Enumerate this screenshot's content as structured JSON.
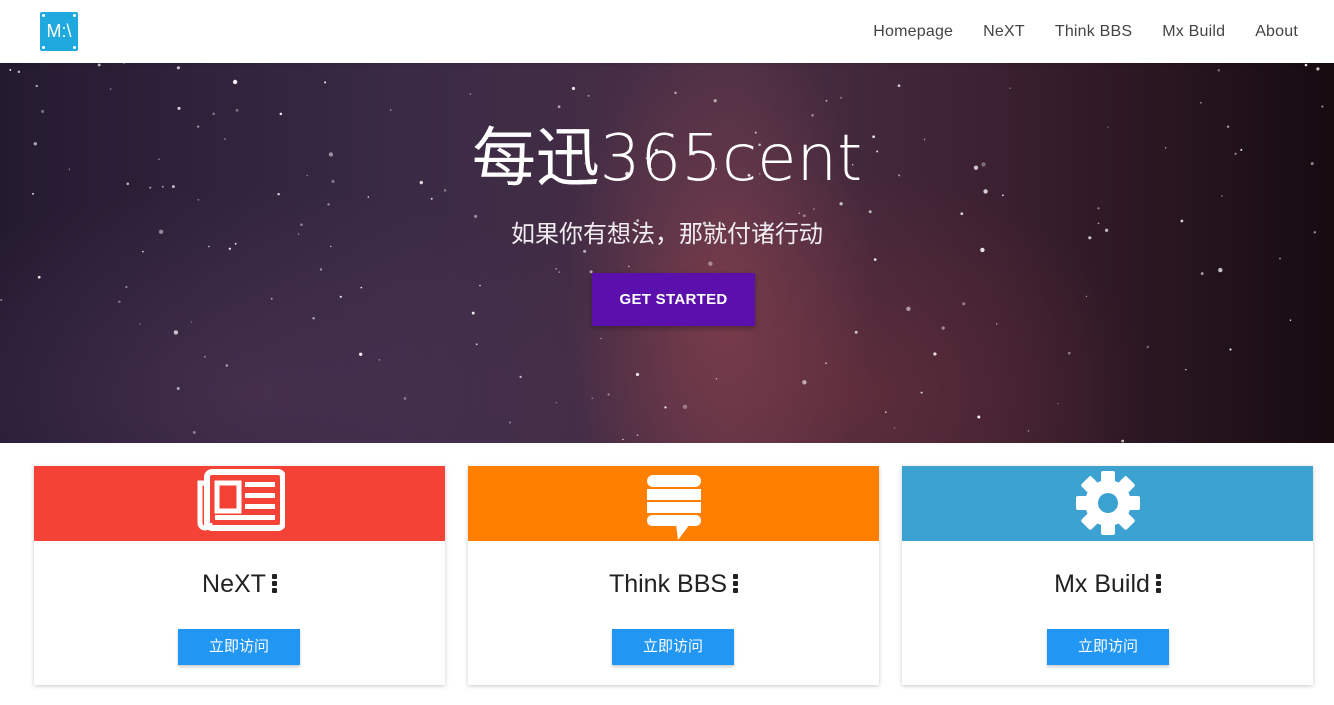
{
  "navbar": {
    "logo_text": "M:\\",
    "links": [
      "Homepage",
      "NeXT",
      "Think BBS",
      "Mx Build",
      "About"
    ]
  },
  "hero": {
    "title": "每迅365cent",
    "subtitle": "如果你有想法，那就付诸行动",
    "cta_label": "GET STARTED"
  },
  "cards": [
    {
      "title": "NeXT",
      "header_color": "#f44336",
      "icon": "newspaper-icon",
      "button_label": "立即访问"
    },
    {
      "title": "Think BBS",
      "header_color": "#ff8000",
      "icon": "forum-icon",
      "button_label": "立即访问"
    },
    {
      "title": "Mx Build",
      "header_color": "#3ba2d1",
      "icon": "gear-icon",
      "button_label": "立即访问"
    }
  ],
  "colors": {
    "cta": "#5b10ae",
    "card_button": "#2196f3",
    "logo": "#1fa9de"
  }
}
